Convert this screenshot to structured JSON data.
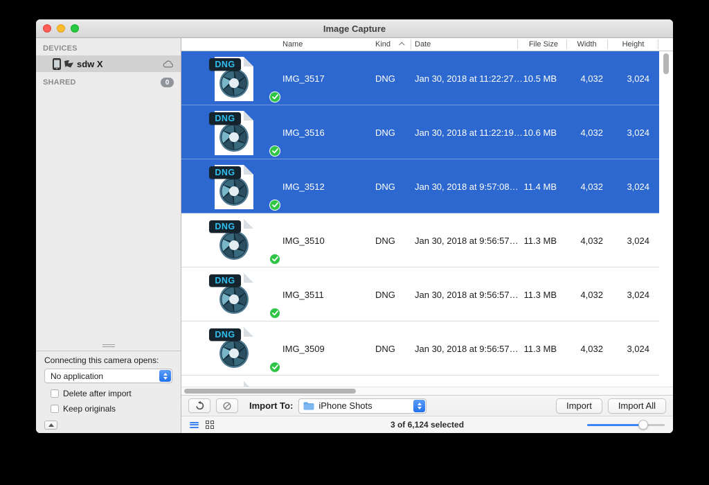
{
  "window": {
    "title": "Image Capture"
  },
  "sidebar": {
    "devices_header": "DEVICES",
    "device": {
      "name": "sdw X"
    },
    "shared_header": "SHARED",
    "shared_badge": "0",
    "camera_opens_label": "Connecting this camera opens:",
    "app_select_value": "No application",
    "checkboxes": [
      {
        "label": "Delete after import",
        "checked": false
      },
      {
        "label": "Keep originals",
        "checked": false
      }
    ]
  },
  "table": {
    "columns": [
      "Name",
      "Kind",
      "Date",
      "File Size",
      "Width",
      "Height"
    ],
    "sort_column": "Kind",
    "sort_direction": "ascending",
    "rows": [
      {
        "name": "IMG_3517",
        "kind": "DNG",
        "date": "Jan 30, 2018 at 11:22:27…",
        "size": "10.5 MB",
        "width": "4,032",
        "height": "3,024",
        "selected": true
      },
      {
        "name": "IMG_3516",
        "kind": "DNG",
        "date": "Jan 30, 2018 at 11:22:19…",
        "size": "10.6 MB",
        "width": "4,032",
        "height": "3,024",
        "selected": true
      },
      {
        "name": "IMG_3512",
        "kind": "DNG",
        "date": "Jan 30, 2018 at 9:57:08…",
        "size": "11.4 MB",
        "width": "4,032",
        "height": "3,024",
        "selected": true
      },
      {
        "name": "IMG_3510",
        "kind": "DNG",
        "date": "Jan 30, 2018 at 9:56:57…",
        "size": "11.3 MB",
        "width": "4,032",
        "height": "3,024",
        "selected": false
      },
      {
        "name": "IMG_3511",
        "kind": "DNG",
        "date": "Jan 30, 2018 at 9:56:57…",
        "size": "11.3 MB",
        "width": "4,032",
        "height": "3,024",
        "selected": false
      },
      {
        "name": "IMG_3509",
        "kind": "DNG",
        "date": "Jan 30, 2018 at 9:56:57…",
        "size": "11.3 MB",
        "width": "4,032",
        "height": "3,024",
        "selected": false
      }
    ]
  },
  "toolbar": {
    "import_to_label": "Import To:",
    "import_to_value": "iPhone Shots",
    "import_label": "Import",
    "import_all_label": "Import All"
  },
  "statusbar": {
    "selection_text": "3 of 6,124 selected",
    "zoom_slider_percent": 72
  },
  "colors": {
    "selection_blue": "#2c68cf",
    "check_green": "#2fc546",
    "dng_badge_bg": "#15232d",
    "dng_badge_text": "#2fc0f0",
    "accent_blue": "#3e82f7"
  }
}
